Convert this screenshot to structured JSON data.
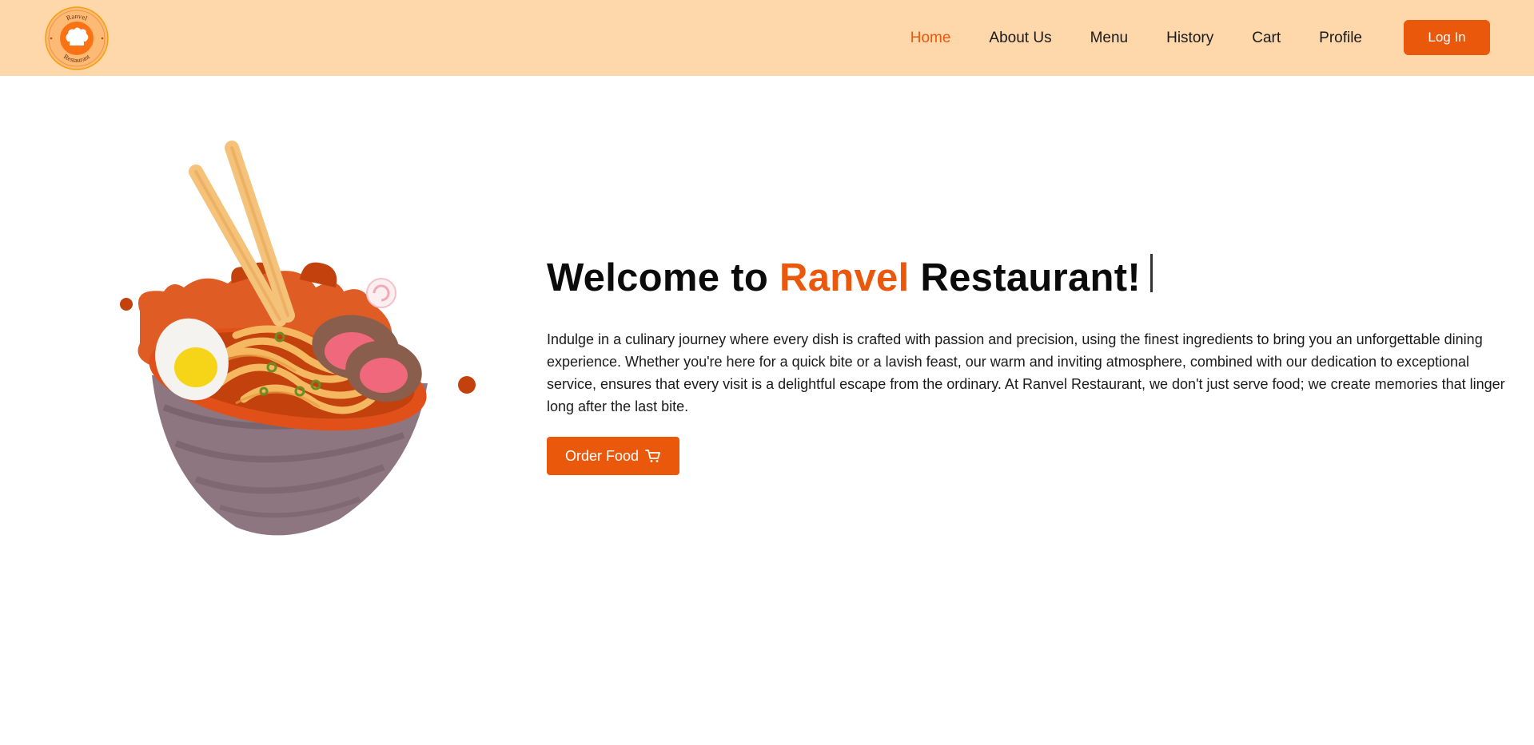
{
  "brand": {
    "name_top": "Ranvel",
    "name_bottom": "Restaurant"
  },
  "nav": {
    "items": [
      {
        "label": "Home",
        "active": true
      },
      {
        "label": "About Us"
      },
      {
        "label": "Menu"
      },
      {
        "label": "History"
      },
      {
        "label": "Cart"
      },
      {
        "label": "Profile"
      }
    ],
    "login_label": "Log In"
  },
  "hero": {
    "title_prefix": "Welcome to ",
    "title_accent": "Ranvel",
    "title_suffix": " Restaurant!",
    "description": "Indulge in a culinary journey where every dish is crafted with passion and precision, using the finest ingredients to bring you an unforgettable dining experience. Whether you're here for a quick bite or a lavish feast, our warm and inviting atmosphere, combined with our dedication to exceptional service, ensures that every visit is a delightful escape from the ordinary. At Ranvel Restaurant, we don't just serve food; we create memories that linger long after the last bite.",
    "order_label": "Order Food",
    "order_icon": "cart-icon"
  },
  "colors": {
    "accent": "#ea580c",
    "navbar_bg": "#fed7aa"
  }
}
